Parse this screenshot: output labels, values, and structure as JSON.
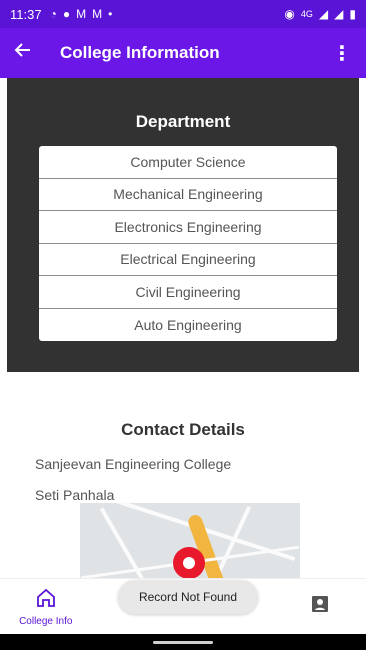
{
  "status_bar": {
    "time": "11:37",
    "network": "4G",
    "icons": [
      "whatsapp-icon",
      "messenger-icon",
      "gmail-icon",
      "gmail-icon",
      "dot-icon",
      "hotspot-icon",
      "signal-icon",
      "signal-icon",
      "battery-icon"
    ]
  },
  "app_bar": {
    "title": "College Information",
    "colors": {
      "app_bar": "#6a17e8",
      "status_bar": "#5a14d6"
    }
  },
  "department": {
    "title": "Department",
    "items": [
      "Computer Science",
      "Mechanical Engineering",
      "Electronics Engineering",
      "Electrical Engineering",
      "Civil Engineering",
      "Auto Engineering"
    ]
  },
  "contact": {
    "title": "Contact Details",
    "college_name": "Sanjeevan Engineering College",
    "location": "Seti Panhala"
  },
  "bottom_nav": {
    "items": [
      {
        "label": "College Info",
        "icon": "home-icon",
        "active": true
      },
      {
        "label": "",
        "icon": "menu-icon",
        "active": false
      },
      {
        "label": "",
        "icon": "document-icon",
        "active": false
      },
      {
        "label": "",
        "icon": "profile-icon",
        "active": false
      }
    ]
  },
  "toast": {
    "message": "Record Not Found"
  }
}
